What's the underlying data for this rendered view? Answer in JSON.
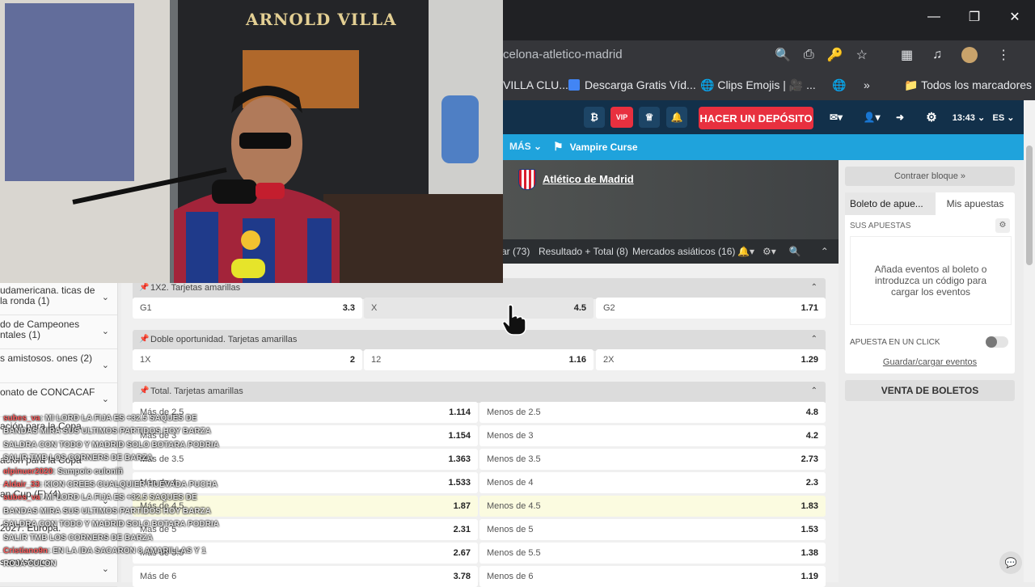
{
  "browser": {
    "url": "celona-atletico-madrid",
    "bookmarks": [
      "VILLA CLU...",
      "Descarga Gratis Víd...",
      "Clips Emojis | 🎥 ...",
      "»",
      "Todos los marcadores"
    ],
    "window_controls": [
      "—",
      "❐",
      "✕"
    ]
  },
  "site": {
    "deposit_label": "HACER UN DEPÓSITO",
    "vip_label": "VIP",
    "time": "13:43 ⌄",
    "lang": "ES ⌄",
    "nav_more": "MÁS ⌄",
    "nav_game": "Vampire Curse",
    "team": "Atlético de Madrid",
    "tabs": [
      "ar (73)",
      "Resultado + Total (8)",
      "Mercados asiáticos (16)"
    ]
  },
  "sidebar": {
    "items": [
      {
        "label": "udamericana. ticas de la ronda (1)"
      },
      {
        "label": "do de Campeones ntales (1)"
      },
      {
        "label": "s amistosos. ones (2)"
      },
      {
        "label": "onato de CONCACAF"
      },
      {
        "label": "ación para la Copa"
      },
      {
        "label": "ación para la Copa"
      },
      {
        "label": "2027. Europa."
      },
      {
        "label": "an Cup (F) (4)"
      },
      {
        "label": "s amistosos"
      }
    ]
  },
  "markets": {
    "m1": {
      "title": "1X2. Tarjetas amarillas",
      "odds": [
        [
          "G1",
          "3.3"
        ],
        [
          "X",
          "4.5"
        ],
        [
          "G2",
          "1.71"
        ]
      ]
    },
    "m2": {
      "title": "Doble oportunidad. Tarjetas amarillas",
      "odds": [
        [
          "1X",
          "2"
        ],
        [
          "12",
          "1.16"
        ],
        [
          "2X",
          "1.29"
        ]
      ]
    },
    "m3": {
      "title": "Total. Tarjetas amarillas",
      "rows": [
        [
          "Más de 2.5",
          "1.114",
          "Menos de 2.5",
          "4.8"
        ],
        [
          "Más de 3",
          "1.154",
          "Menos de 3",
          "4.2"
        ],
        [
          "Más de 3.5",
          "1.363",
          "Menos de 3.5",
          "2.73"
        ],
        [
          "Más de 4",
          "1.533",
          "Menos de 4",
          "2.3"
        ],
        [
          "Más de 4.5",
          "1.87",
          "Menos de 4.5",
          "1.83"
        ],
        [
          "Más de 5",
          "2.31",
          "Menos de 5",
          "1.53"
        ],
        [
          "Más de 5.5",
          "2.67",
          "Menos de 5.5",
          "1.38"
        ],
        [
          "Más de 6",
          "3.78",
          "Menos de 6",
          "1.19"
        ]
      ]
    }
  },
  "slip": {
    "contraer": "Contraer bloque »",
    "tab_boleto": "Boleto de apue...",
    "tab_mis": "Mis apuestas",
    "sus": "SUS APUESTAS",
    "empty": "Añada eventos al boleto o introduzca un código para cargar los eventos",
    "oneclick": "APUESTA EN UN CLICK",
    "guardar": "Guardar/cargar eventos",
    "venta": "VENTA DE BOLETOS"
  },
  "stream": {
    "wall_text": "ARNOLD VILLA",
    "chat": [
      {
        "user": "subes_va",
        "msg": ": MI LORD LA FIJA ES +32.5 SAQUES DE"
      },
      {
        "user": "",
        "msg": "BANDAS MIRA SUS ULTIMOS PARTIDOS HOY BARZA"
      },
      {
        "user": "",
        "msg": "SALDRA CON TODO Y MADRID SOLO BOTARA PODRIA"
      },
      {
        "user": "",
        "msg": "SALIR TMB LOS CORNERS DE BARZA"
      },
      {
        "user": "elpinuer2020",
        "msg": ": Sampoio culoniñ"
      },
      {
        "user": "Aldair_33",
        "msg": ": KION CREES CUALQUIER HUEVADA PUCHA"
      },
      {
        "user": "subes_va",
        "msg": ": MI LORD LA FIJA ES +32.5 SAQUES DE"
      },
      {
        "user": "",
        "msg": "BANDAS MIRA SUS ULTIMOS PARTIDOS HOY BARZA"
      },
      {
        "user": "",
        "msg": "SALDRA CON TODO Y MADRID SOLO BOTARA PODRIA"
      },
      {
        "user": "",
        "msg": "SALIR TMB LOS CORNERS DE BARZA"
      },
      {
        "user": "Cristiano9n",
        "msg": ": EN LA IDA SACARON 8 AMARILLAS Y 1"
      },
      {
        "user": "",
        "msg": "ROJA CULON"
      }
    ]
  }
}
